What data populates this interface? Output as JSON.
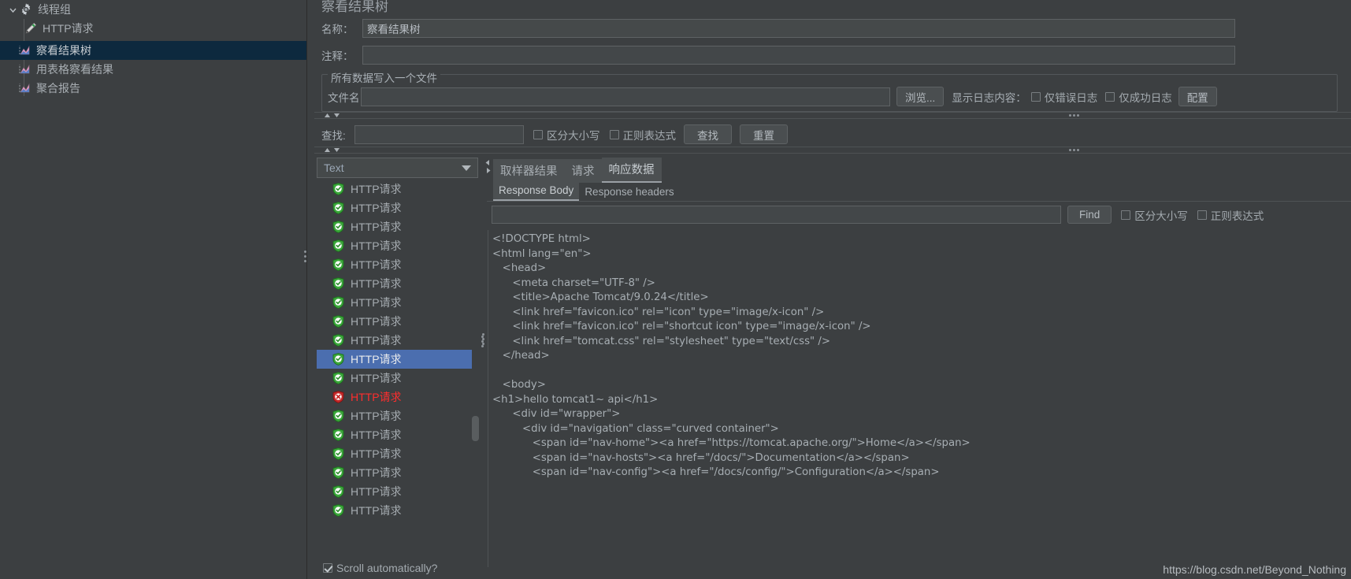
{
  "tree": {
    "items": [
      {
        "label": "线程组",
        "icon": "gear-icon",
        "depth": 0,
        "selected": false,
        "expanded": true
      },
      {
        "label": "HTTP请求",
        "icon": "pencil-icon",
        "depth": 2,
        "selected": false
      },
      {
        "label": "察看结果树",
        "icon": "chart-icon",
        "depth": 1,
        "selected": true
      },
      {
        "label": "用表格察看结果",
        "icon": "chart-icon",
        "depth": 1,
        "selected": false
      },
      {
        "label": "聚合报告",
        "icon": "chart-icon",
        "depth": 1,
        "selected": false
      }
    ]
  },
  "panel": {
    "title": "察看结果树",
    "name_label": "名称：",
    "name_value": "察看结果树",
    "comment_label": "注释：",
    "comment_value": "",
    "file_group_title": "所有数据写入一个文件",
    "filename_label": "文件名",
    "filename_value": "",
    "browse_button": "浏览...",
    "log_display_label": "显示日志内容：",
    "errors_only_label": "仅错误日志",
    "errors_only_checked": false,
    "success_only_label": "仅成功日志",
    "success_only_checked": false,
    "configure_button": "配置"
  },
  "search": {
    "label": "查找:",
    "value": "",
    "case_sensitive_label": "区分大小写",
    "case_sensitive_checked": false,
    "regex_label": "正则表达式",
    "regex_checked": false,
    "find_button": "查找",
    "reset_button": "重置"
  },
  "results": {
    "view_mode": "Text",
    "scroll_auto_label": "Scroll automatically?",
    "scroll_auto_checked": true,
    "rows": [
      {
        "label": "HTTP请求",
        "status": "ok",
        "selected": false
      },
      {
        "label": "HTTP请求",
        "status": "ok",
        "selected": false
      },
      {
        "label": "HTTP请求",
        "status": "ok",
        "selected": false
      },
      {
        "label": "HTTP请求",
        "status": "ok",
        "selected": false
      },
      {
        "label": "HTTP请求",
        "status": "ok",
        "selected": false
      },
      {
        "label": "HTTP请求",
        "status": "ok",
        "selected": false
      },
      {
        "label": "HTTP请求",
        "status": "ok",
        "selected": false
      },
      {
        "label": "HTTP请求",
        "status": "ok",
        "selected": false
      },
      {
        "label": "HTTP请求",
        "status": "ok",
        "selected": false
      },
      {
        "label": "HTTP请求",
        "status": "ok",
        "selected": true
      },
      {
        "label": "HTTP请求",
        "status": "ok",
        "selected": false
      },
      {
        "label": "HTTP请求",
        "status": "error",
        "selected": false
      },
      {
        "label": "HTTP请求",
        "status": "ok",
        "selected": false
      },
      {
        "label": "HTTP请求",
        "status": "ok",
        "selected": false
      },
      {
        "label": "HTTP请求",
        "status": "ok",
        "selected": false
      },
      {
        "label": "HTTP请求",
        "status": "ok",
        "selected": false
      },
      {
        "label": "HTTP请求",
        "status": "ok",
        "selected": false
      },
      {
        "label": "HTTP请求",
        "status": "ok",
        "selected": false
      }
    ]
  },
  "detail": {
    "tabs": [
      {
        "label": "取样器结果",
        "active": false
      },
      {
        "label": "请求",
        "active": false
      },
      {
        "label": "响应数据",
        "active": true
      }
    ],
    "subtabs": [
      {
        "label": "Response Body",
        "active": true
      },
      {
        "label": "Response headers",
        "active": false
      }
    ],
    "find": {
      "value": "",
      "button": "Find",
      "case_sensitive_label": "区分大小写",
      "case_sensitive_checked": false,
      "regex_label": "正则表达式",
      "regex_checked": false
    },
    "response_body": "<!DOCTYPE html>\n<html lang=\"en\">\n   <head>\n      <meta charset=\"UTF-8\" />\n      <title>Apache Tomcat/9.0.24</title>\n      <link href=\"favicon.ico\" rel=\"icon\" type=\"image/x-icon\" />\n      <link href=\"favicon.ico\" rel=\"shortcut icon\" type=\"image/x-icon\" />\n      <link href=\"tomcat.css\" rel=\"stylesheet\" type=\"text/css\" />\n   </head>\n\n   <body>\n<h1>hello tomcat1~ api</h1>\n      <div id=\"wrapper\">\n         <div id=\"navigation\" class=\"curved container\">\n            <span id=\"nav-home\"><a href=\"https://tomcat.apache.org/\">Home</a></span>\n            <span id=\"nav-hosts\"><a href=\"/docs/\">Documentation</a></span>\n            <span id=\"nav-config\"><a href=\"/docs/config/\">Configuration</a></span>"
  },
  "watermark": "https://blog.csdn.net/Beyond_Nothing",
  "colors": {
    "background": "#3c3f41",
    "selection_blue": "#4b6eaf",
    "tree_selection": "#0d293e",
    "error_red": "#ff2d2d",
    "ok_green": "#3aa83a"
  }
}
